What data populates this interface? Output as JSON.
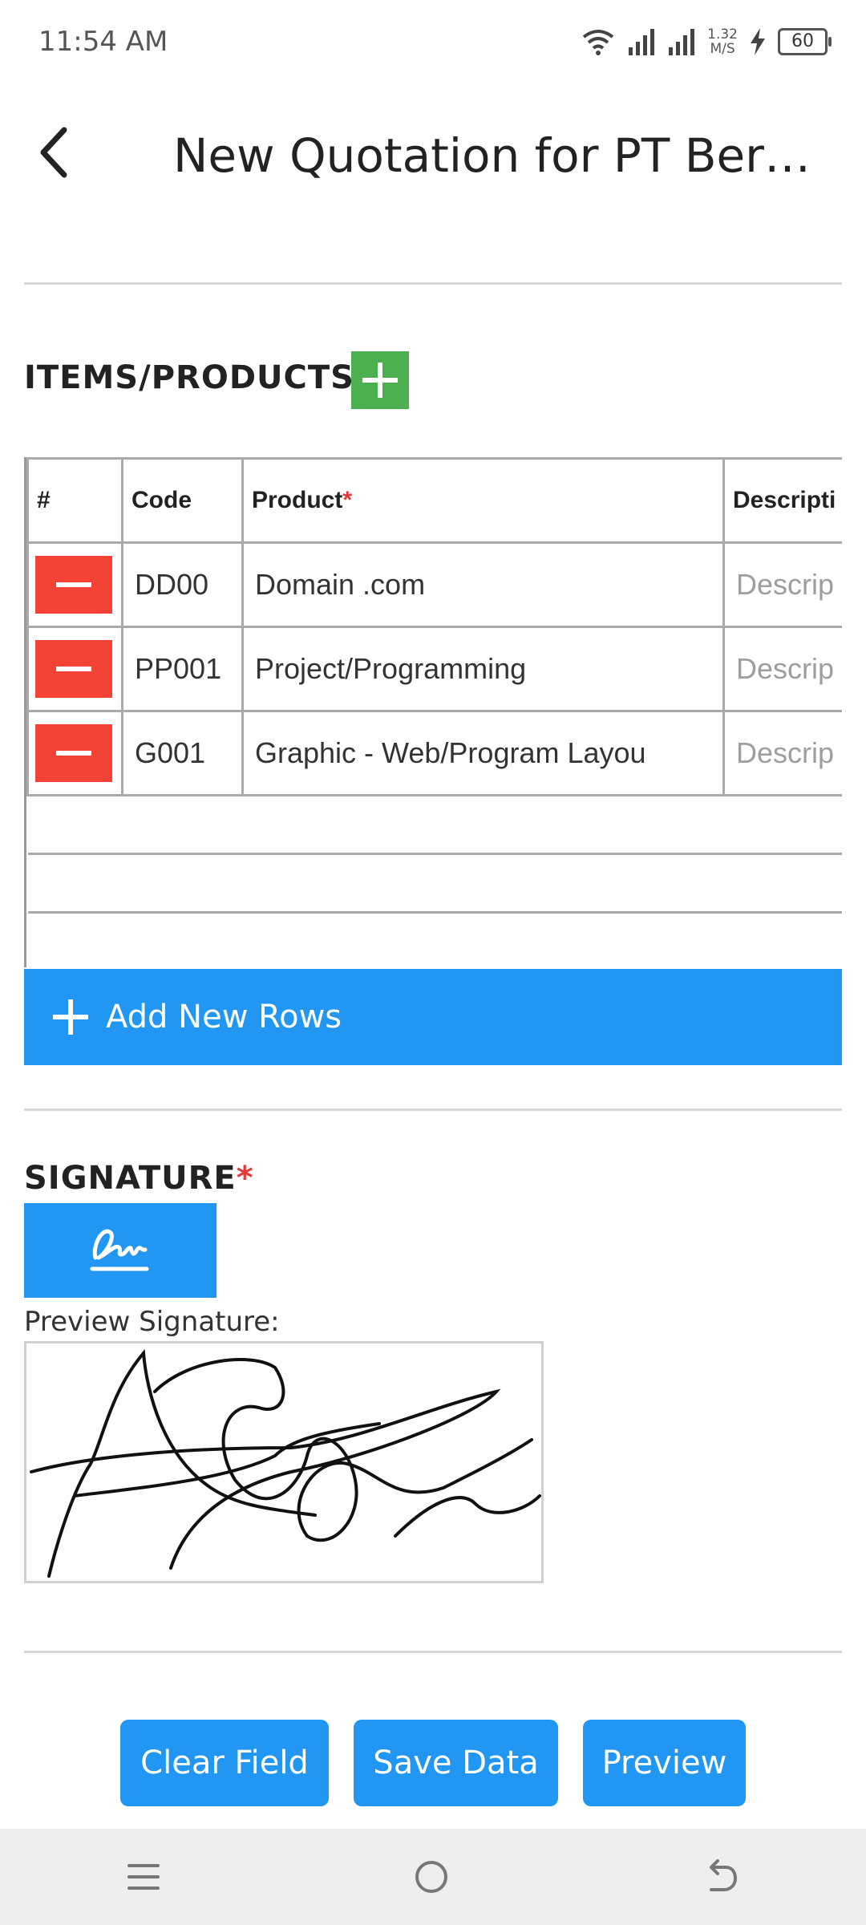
{
  "status_bar": {
    "time": "11:54 AM",
    "speed_value": "1.32",
    "speed_unit": "M/S",
    "battery": "60"
  },
  "header": {
    "title": "New Quotation for PT Berka..."
  },
  "items": {
    "section_title": "ITEMS/PRODUCTS",
    "columns": [
      "#",
      "Code",
      "Product",
      "Descripti"
    ],
    "required_mark": "*",
    "rows": [
      {
        "code": "DD00",
        "product": "Domain .com",
        "description_placeholder": "Descrip"
      },
      {
        "code": "PP001",
        "product": "Project/Programming",
        "description_placeholder": "Descrip"
      },
      {
        "code": "G001",
        "product": "Graphic - Web/Program Layou",
        "description_placeholder": "Descrip"
      }
    ],
    "add_rows_label": "Add New Rows"
  },
  "signature": {
    "section_title": "SIGNATURE",
    "required_mark": "*",
    "preview_label": "Preview Signature:"
  },
  "actions": {
    "clear": "Clear Field",
    "save": "Save Data",
    "preview": "Preview"
  },
  "colors": {
    "primary": "#2196f3",
    "add_green": "#4caf50",
    "remove_red": "#f44336",
    "required": "#e53935"
  },
  "icons": {
    "back": "back-arrow-icon",
    "signature": "signature-icon",
    "nav_menu": "menu-icon",
    "nav_home": "home-icon",
    "nav_back": "nav-back-icon"
  }
}
